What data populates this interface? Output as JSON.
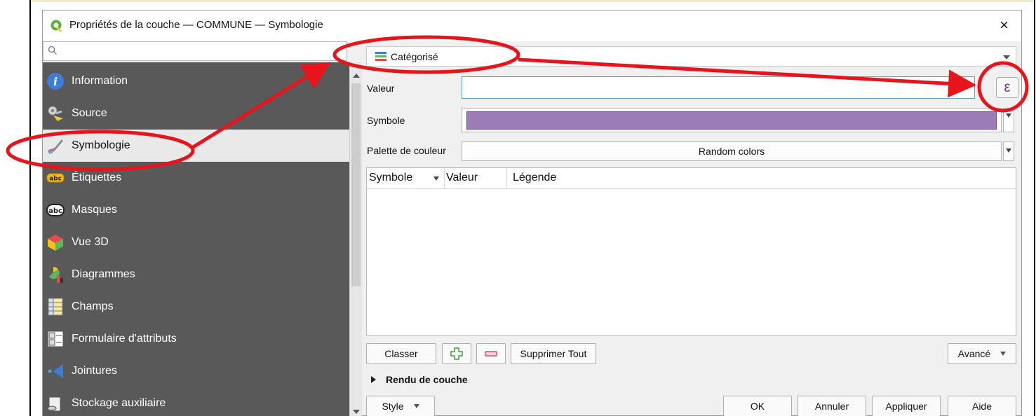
{
  "window": {
    "title": "Propriétés de la couche — COMMUNE — Symbologie",
    "close_glyph": "×"
  },
  "search": {
    "placeholder": "",
    "value": ""
  },
  "sidebar": {
    "items": [
      {
        "label": "Information",
        "icon": "information-icon",
        "selected": false
      },
      {
        "label": "Source",
        "icon": "source-icon",
        "selected": false
      },
      {
        "label": "Symbologie",
        "icon": "paintbrush-icon",
        "selected": true
      },
      {
        "label": "Étiquettes",
        "icon": "labels-icon",
        "selected": false
      },
      {
        "label": "Masques",
        "icon": "masks-icon",
        "selected": false
      },
      {
        "label": "Vue 3D",
        "icon": "cube-3d-icon",
        "selected": false
      },
      {
        "label": "Diagrammes",
        "icon": "diagram-icon",
        "selected": false
      },
      {
        "label": "Champs",
        "icon": "fields-icon",
        "selected": false
      },
      {
        "label": "Formulaire d'attributs",
        "icon": "form-icon",
        "selected": false
      },
      {
        "label": "Jointures",
        "icon": "joins-icon",
        "selected": false
      },
      {
        "label": "Stockage auxiliaire",
        "icon": "storage-icon",
        "selected": false
      }
    ]
  },
  "renderer": {
    "selected": "Catégorisé",
    "icon": "categorized-icon"
  },
  "form": {
    "valeur_label": "Valeur",
    "valeur_value": "",
    "expression_glyph": "ε",
    "symbole_label": "Symbole",
    "symbol_color": "#9d7bb6",
    "palette_label": "Palette de couleur",
    "palette_value": "Random colors"
  },
  "table": {
    "columns": [
      "Symbole",
      "Valeur",
      "Légende"
    ],
    "rows": []
  },
  "actions": {
    "classer": "Classer",
    "add_icon": "plus-icon",
    "remove_icon": "minus-icon",
    "supprimer_tout": "Supprimer Tout",
    "avance": "Avancé"
  },
  "section": {
    "rendu": "Rendu de couche"
  },
  "footer": {
    "style": "Style",
    "ok": "OK",
    "annuler": "Annuler",
    "appliquer": "Appliquer",
    "aide": "Aide"
  },
  "colors": {
    "annotation": "#e8141c",
    "sidebar_bg": "#595959",
    "selected_bg": "#e9e9e9",
    "focus_border": "#5aa0d8",
    "expression": "#7a3a7f"
  }
}
